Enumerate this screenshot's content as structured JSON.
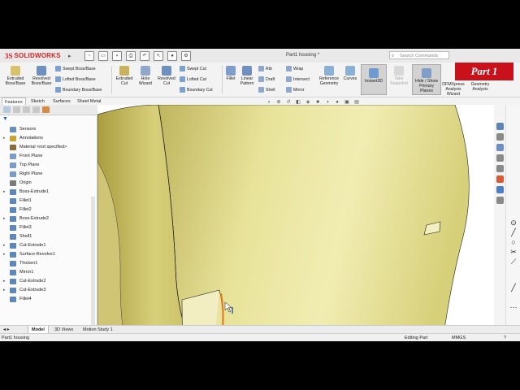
{
  "app": {
    "brand_prefix": "3S",
    "brand_name": "SOLIDWORKS",
    "document_title": "Part1 housing *",
    "search_placeholder": "Search Commands",
    "overlay_badge": "Part 1"
  },
  "ribbon": {
    "extruded_boss": "Extruded Boss/Base",
    "revolved_boss": "Revolved Boss/Base",
    "swept_boss": "Swept Boss/Base",
    "lofted_boss": "Lofted Boss/Base",
    "boundary_boss": "Boundary Boss/Base",
    "extruded_cut": "Extruded Cut",
    "hole_wizard": "Hole Wizard",
    "revolved_cut": "Revolved Cut",
    "swept_cut": "Swept Cut",
    "lofted_cut": "Lofted Cut",
    "boundary_cut": "Boundary Cut",
    "fillet": "Fillet",
    "linear_pattern": "Linear Pattern",
    "rib": "Rib",
    "draft": "Draft",
    "shell": "Shell",
    "wrap": "Wrap",
    "intersect": "Intersect",
    "mirror": "Mirror",
    "reference_geometry": "Reference Geometry",
    "curves": "Curves",
    "instant3d": "Instant3D",
    "take_snapshot": "Take Snapshot",
    "hide_show_planes": "Hide / Show Primary Planes",
    "dfmxpress": "DFMXpress Analysis Wizard",
    "geometry_analysis": "Geometry Analysis"
  },
  "command_tabs": [
    "Features",
    "Sketch",
    "Surfaces",
    "Sheet Metal"
  ],
  "tree": [
    {
      "label": "Sensors",
      "arrow": "",
      "color": "#6a8fb5"
    },
    {
      "label": "Annotations",
      "arrow": "▸",
      "color": "#c7a334"
    },
    {
      "label": "Material <not specified>",
      "arrow": "",
      "color": "#8a6d3b"
    },
    {
      "label": "Front Plane",
      "arrow": "",
      "color": "#7a9cc6"
    },
    {
      "label": "Top Plane",
      "arrow": "",
      "color": "#7a9cc6"
    },
    {
      "label": "Right Plane",
      "arrow": "",
      "color": "#7a9cc6"
    },
    {
      "label": "Origin",
      "arrow": "",
      "color": "#7a7a7a"
    },
    {
      "label": "Boss-Extrude1",
      "arrow": "▸",
      "color": "#5c87b8"
    },
    {
      "label": "Fillet1",
      "arrow": "",
      "color": "#5c87b8"
    },
    {
      "label": "Fillet2",
      "arrow": "",
      "color": "#5c87b8"
    },
    {
      "label": "Boss-Extrude2",
      "arrow": "▸",
      "color": "#5c87b8"
    },
    {
      "label": "Fillet3",
      "arrow": "",
      "color": "#5c87b8"
    },
    {
      "label": "Shell1",
      "arrow": "",
      "color": "#5c87b8"
    },
    {
      "label": "Cut-Extrude1",
      "arrow": "▸",
      "color": "#5c87b8"
    },
    {
      "label": "Surface-Revolve1",
      "arrow": "▸",
      "color": "#5c87b8"
    },
    {
      "label": "Thicken1",
      "arrow": "",
      "color": "#5c87b8"
    },
    {
      "label": "Mirror1",
      "arrow": "",
      "color": "#5c87b8"
    },
    {
      "label": "Cut-Extrude2",
      "arrow": "▸",
      "color": "#5c87b8"
    },
    {
      "label": "Cut-Extrude3",
      "arrow": "▸",
      "color": "#5c87b8"
    },
    {
      "label": "Fillet4",
      "arrow": "",
      "color": "#5c87b8"
    }
  ],
  "bottom_tabs": [
    "Model",
    "3D Views",
    "Motion Study 1"
  ],
  "status": {
    "left": "Part1 housing",
    "mode": "Editing Part",
    "units": "MMGS"
  },
  "colors": {
    "brand": "#d22222",
    "badge": "#c8111a",
    "model_body": "#e6e090",
    "selected_edge": "#e07a10"
  }
}
